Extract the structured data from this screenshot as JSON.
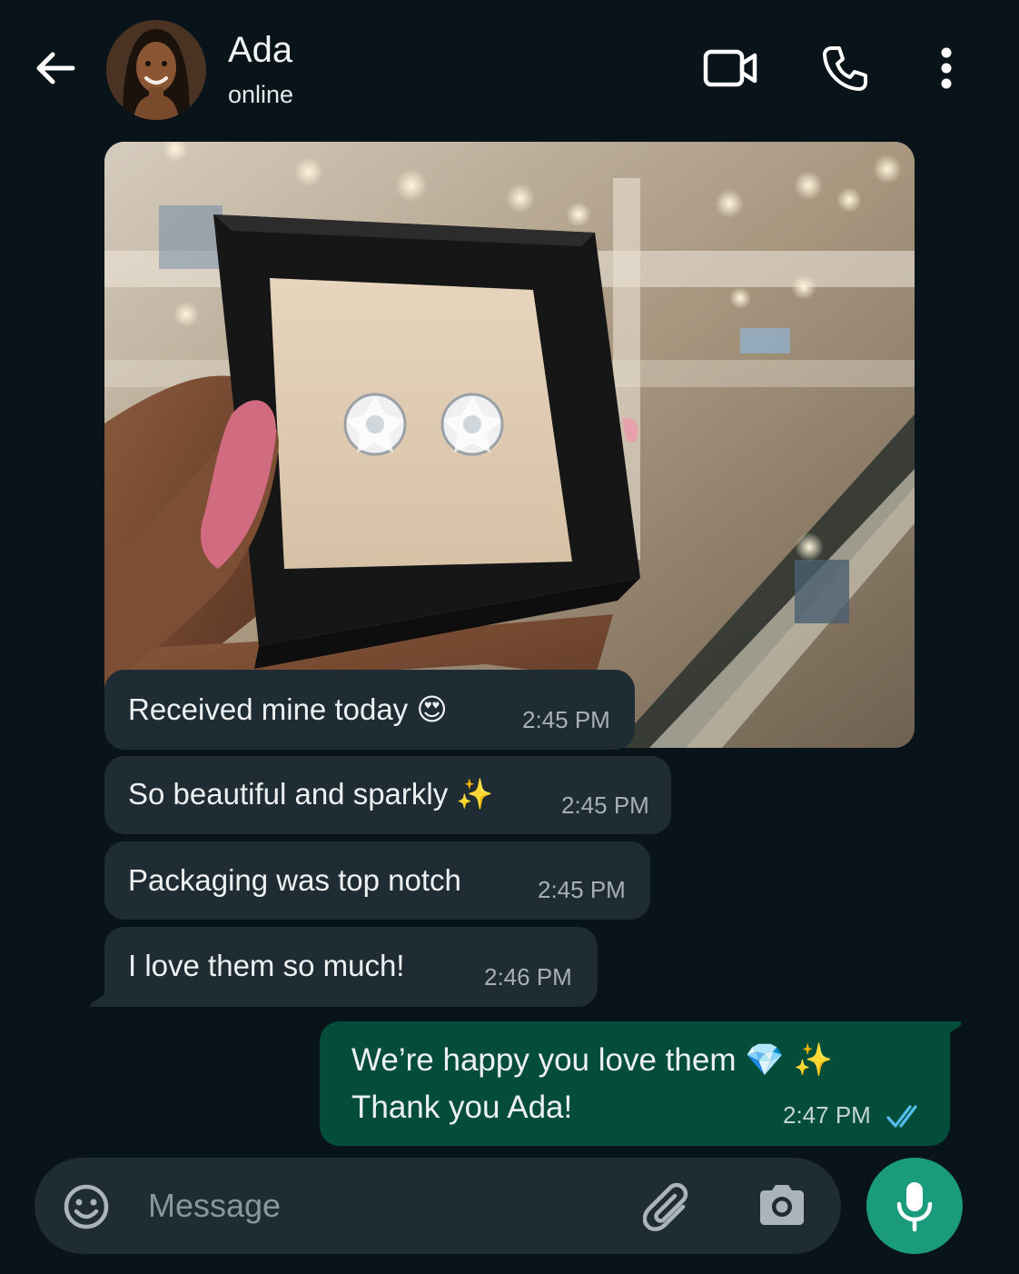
{
  "header": {
    "contact_name": "Ada",
    "status": "online"
  },
  "messages": [
    {
      "text": "Received mine today 😍",
      "time": "2:45 PM",
      "direction": "incoming"
    },
    {
      "text": "So beautiful and sparkly ✨",
      "time": "2:45 PM",
      "direction": "incoming"
    },
    {
      "text": "Packaging was top notch",
      "time": "2:45 PM",
      "direction": "incoming"
    },
    {
      "text": "I love them so much!",
      "time": "2:46 PM",
      "direction": "incoming"
    },
    {
      "line1": "We’re happy you love them 💎 ✨",
      "line2": "Thank you Ada!",
      "time": "2:47 PM",
      "direction": "outgoing",
      "status": "read"
    }
  ],
  "composer": {
    "placeholder": "Message"
  },
  "colors": {
    "background": "#08131a",
    "incoming_bubble": "#1f2c33",
    "outgoing_bubble": "#054d3b",
    "accent": "#1a9b7b",
    "read_ticks": "#53bdeb"
  },
  "icons": [
    "back-arrow-icon",
    "video-call-icon",
    "phone-icon",
    "more-vert-icon",
    "emoji-icon",
    "attach-icon",
    "camera-icon",
    "mic-icon",
    "double-check-icon"
  ]
}
